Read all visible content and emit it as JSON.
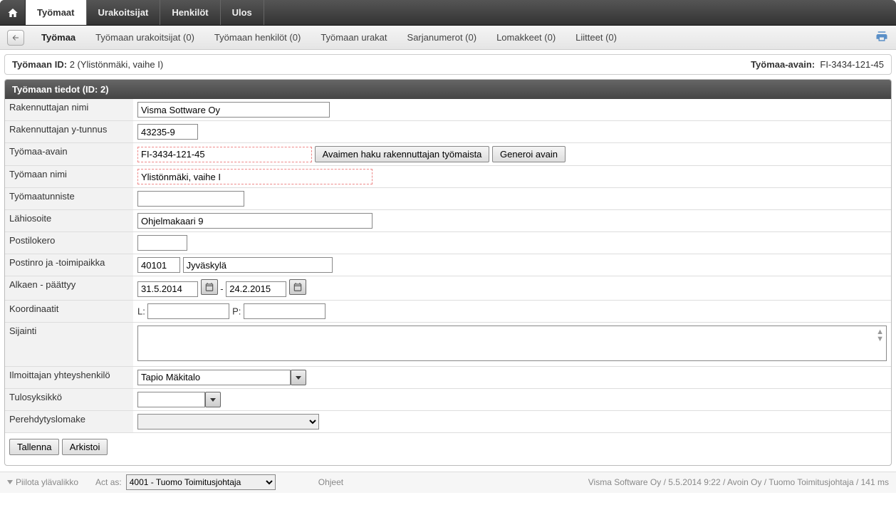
{
  "topnav": {
    "tabs": [
      "Työmaat",
      "Urakoitsijat",
      "Henkilöt",
      "Ulos"
    ],
    "active": 0
  },
  "subnav": {
    "items": [
      {
        "label": "Työmaa"
      },
      {
        "label": "Työmaan urakoitsijat (0)"
      },
      {
        "label": "Työmaan henkilöt (0)"
      },
      {
        "label": "Työmaan urakat"
      },
      {
        "label": "Sarjanumerot (0)"
      },
      {
        "label": "Lomakkeet (0)"
      },
      {
        "label": "Liitteet (0)"
      }
    ],
    "active": 0
  },
  "header": {
    "id_label": "Työmaan ID:",
    "id_value": "2 (Ylistönmäki, vaihe I)",
    "key_label": "Työmaa-avain:",
    "key_value": "FI-3434-121-45"
  },
  "panel_title": "Työmaan tiedot (ID: 2)",
  "fields": {
    "rakennuttaja_label": "Rakennuttajan nimi",
    "rakennuttaja_value": "Visma Sottware Oy",
    "ytunnus_label": "Rakennuttajan y-tunnus",
    "ytunnus_value": "43235-9",
    "avain_label": "Työmaa-avain",
    "avain_value": "FI-3434-121-45",
    "avain_btn1": "Avaimen haku rakennuttajan työmaista",
    "avain_btn2": "Generoi avain",
    "tyomaan_nimi_label": "Työmaan nimi",
    "tyomaan_nimi_value": "Ylistönmäki, vaihe I",
    "tunniste_label": "Työmaatunniste",
    "tunniste_value": "",
    "lahiosoite_label": "Lähiosoite",
    "lahiosoite_value": "Ohjelmakaari 9",
    "postilokero_label": "Postilokero",
    "postilokero_value": "",
    "postinro_label": "Postinro ja -toimipaikka",
    "postinro_value": "40101",
    "postitp_value": "Jyväskylä",
    "alkaen_label": "Alkaen - päättyy",
    "alkaen_value": "31.5.2014",
    "paattyy_value": "24.2.2015",
    "dash": "-",
    "koord_label": "Koordinaatit",
    "koord_l": "L:",
    "koord_p": "P:",
    "koord_l_value": "",
    "koord_p_value": "",
    "sijainti_label": "Sijainti",
    "sijainti_value": "",
    "ilmoittaja_label": "Ilmoittajan yhteyshenkilö",
    "ilmoittaja_value": "Tapio Mäkitalo",
    "tulosyks_label": "Tulosyksikkö",
    "tulosyks_value": "",
    "perehdytys_label": "Perehdytyslomake"
  },
  "buttons": {
    "save": "Tallenna",
    "archive": "Arkistoi"
  },
  "footer": {
    "hide": "Piilota ylävalikko",
    "actas": "Act as:",
    "actas_value": "4001 - Tuomo Toimitusjohtaja",
    "help": "Ohjeet",
    "status": "Visma Software Oy / 5.5.2014 9:22 / Avoin Oy / Tuomo Toimitusjohtaja / 141 ms"
  }
}
